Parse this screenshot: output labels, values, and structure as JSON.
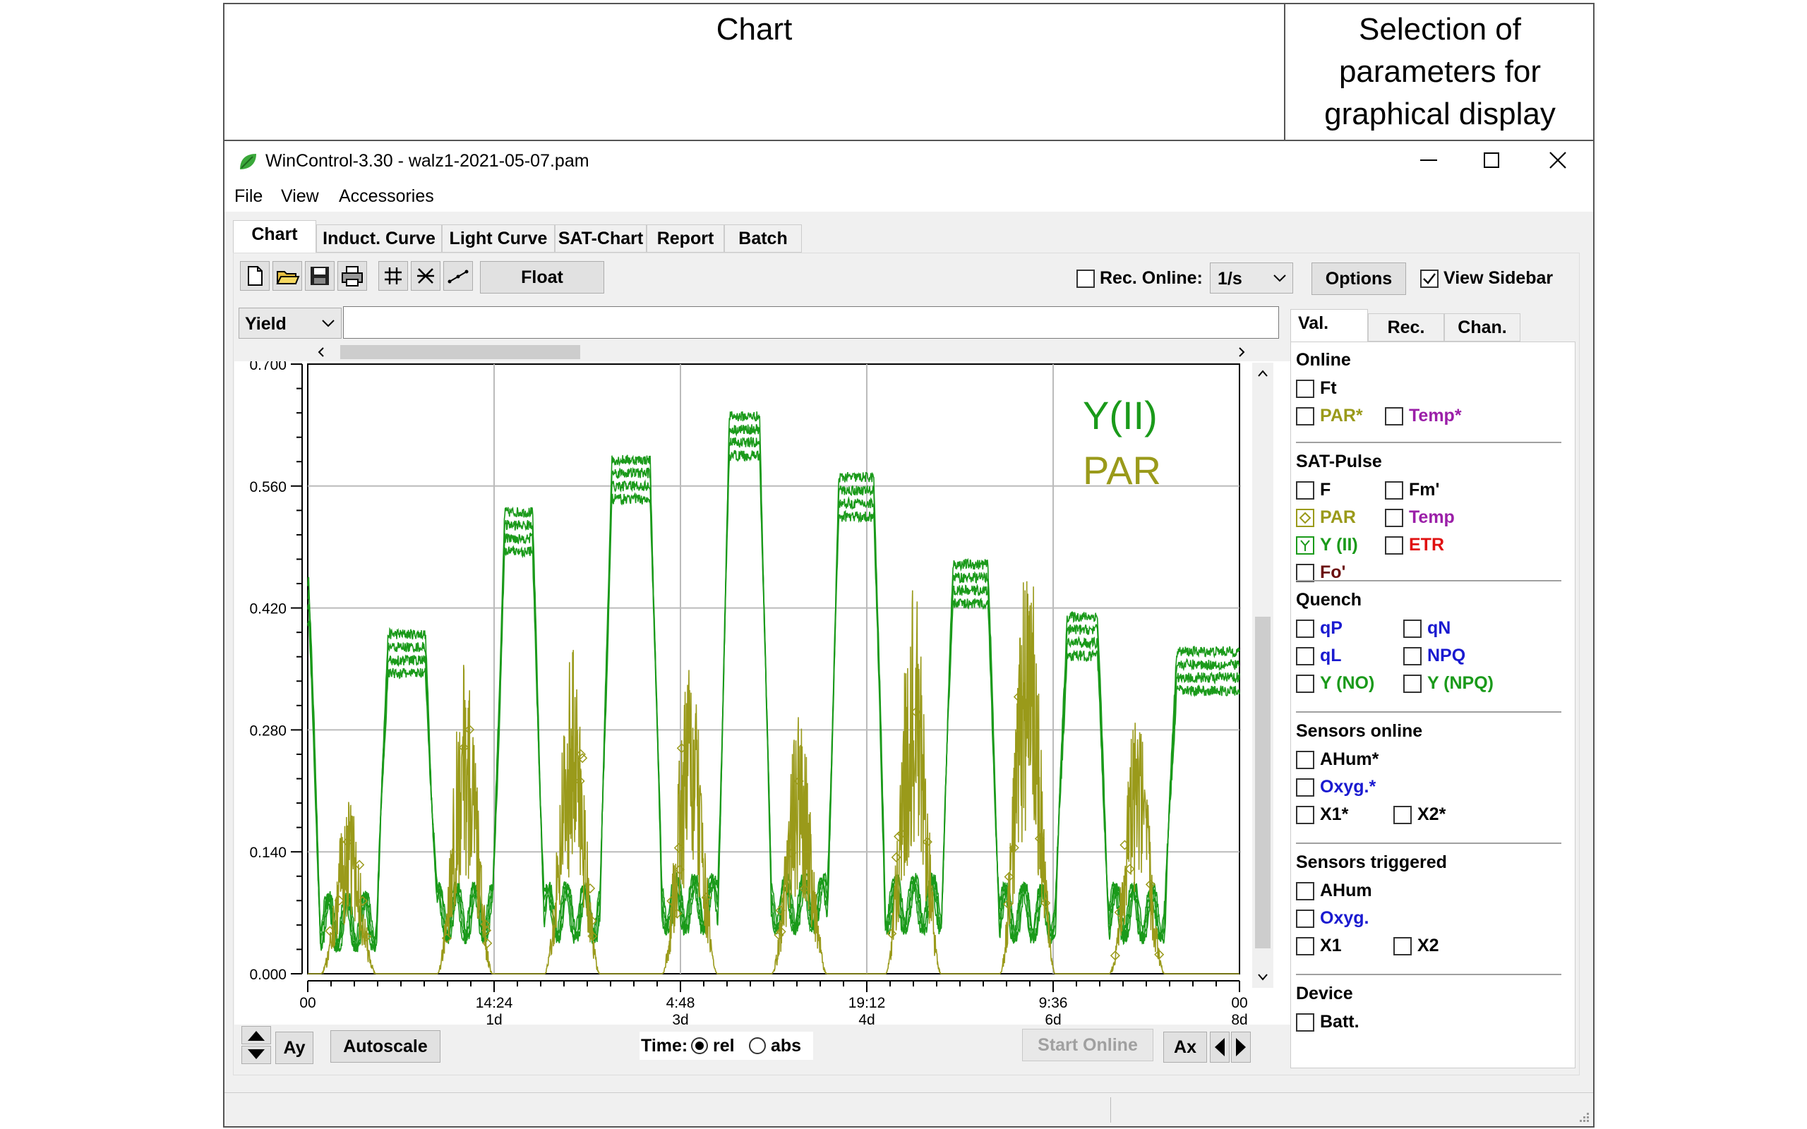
{
  "annotations": {
    "left": "Chart",
    "right": "Selection of parameters for graphical display"
  },
  "window": {
    "title": "WinControl-3.30 - walz1-2021-05-07.pam"
  },
  "menu": [
    "File",
    "View",
    "Accessories"
  ],
  "tabs": [
    "Chart",
    "Induct. Curve",
    "Light Curve",
    "SAT-Chart",
    "Report",
    "Batch"
  ],
  "toolbar": {
    "float_label": "Float",
    "rec_online_label": "Rec. Online:",
    "rec_interval": "1/s",
    "options_label": "Options",
    "view_sidebar_label": "View Sidebar",
    "view_sidebar_checked": true,
    "rec_online_checked": false
  },
  "param_select": {
    "value": "Yield"
  },
  "overlay_labels": {
    "yii": "Y(II)",
    "par": "PAR"
  },
  "bottom": {
    "ay": "Ay",
    "autoscale": "Autoscale",
    "time_label": "Time:",
    "rel": "rel",
    "abs": "abs",
    "start_online": "Start Online",
    "ax": "Ax"
  },
  "sidebar": {
    "tabs": [
      "Val.",
      "Rec.",
      "Chan."
    ],
    "sections": [
      {
        "title": "Online",
        "items": [
          {
            "label": "Ft",
            "color": "#000000",
            "checked": false
          },
          {
            "label": "PAR*",
            "color": "#9a9a1a",
            "checked": false
          },
          {
            "label": "Temp*",
            "color": "#9b1fa8",
            "checked": false
          }
        ]
      },
      {
        "title": "SAT-Pulse",
        "items": [
          {
            "label": "F",
            "color": "#000000",
            "checked": false
          },
          {
            "label": "Fm'",
            "color": "#000000",
            "checked": false
          },
          {
            "label": "PAR",
            "color": "#9a9a1a",
            "checked": true
          },
          {
            "label": "Temp",
            "color": "#9b1fa8",
            "checked": false
          },
          {
            "label": "Y (II)",
            "color": "#1a9a1a",
            "checked": true
          },
          {
            "label": "ETR",
            "color": "#e01010",
            "checked": false
          },
          {
            "label": "Fo'",
            "color": "#6b1010",
            "checked": false
          }
        ]
      },
      {
        "title": "Quench",
        "items": [
          {
            "label": "qP",
            "color": "#1a1ad0",
            "checked": false
          },
          {
            "label": "qN",
            "color": "#1a1ad0",
            "checked": false
          },
          {
            "label": "qL",
            "color": "#1a1ad0",
            "checked": false
          },
          {
            "label": "NPQ",
            "color": "#1a1ad0",
            "checked": false
          },
          {
            "label": "Y (NO)",
            "color": "#1a9a1a",
            "checked": false
          },
          {
            "label": "Y (NPQ)",
            "color": "#1a9a1a",
            "checked": false
          }
        ]
      },
      {
        "title": "Sensors online",
        "items": [
          {
            "label": "AHum*",
            "color": "#000000",
            "checked": false
          },
          {
            "label": "Oxyg.*",
            "color": "#1a1ad0",
            "checked": false
          },
          {
            "label": "X1*",
            "color": "#000000",
            "checked": false
          },
          {
            "label": "X2*",
            "color": "#000000",
            "checked": false
          }
        ]
      },
      {
        "title": "Sensors triggered",
        "items": [
          {
            "label": "AHum",
            "color": "#000000",
            "checked": false
          },
          {
            "label": "Oxyg.",
            "color": "#1a1ad0",
            "checked": false
          },
          {
            "label": "X1",
            "color": "#000000",
            "checked": false
          },
          {
            "label": "X2",
            "color": "#000000",
            "checked": false
          }
        ]
      },
      {
        "title": "Device",
        "items": [
          {
            "label": "Batt.",
            "color": "#000000",
            "checked": false
          }
        ]
      }
    ]
  },
  "chart_data": {
    "type": "line",
    "title": "",
    "ylim": [
      0,
      0.7
    ],
    "y_ticks": [
      "0.700",
      "0.560",
      "0.420",
      "0.280",
      "0.140",
      "0.000"
    ],
    "y_tick_values": [
      0.7,
      0.56,
      0.42,
      0.28,
      0.14,
      0
    ],
    "x_ticks": [
      {
        "time": "00",
        "day": ""
      },
      {
        "time": "14:24",
        "day": "1d"
      },
      {
        "time": "4:48",
        "day": "3d"
      },
      {
        "time": "19:12",
        "day": "4d"
      },
      {
        "time": "9:36",
        "day": "6d"
      },
      {
        "time": "00",
        "day": "8d"
      }
    ],
    "x_tick_days": [
      0,
      1.6,
      3.2,
      4.8,
      6.4,
      8.0
    ],
    "xlim_days": [
      0,
      8
    ],
    "grid": true,
    "series": [
      {
        "name": "Y(II)",
        "color": "#1a9a1a",
        "night_levels": [
          0.45,
          0.39,
          0.53,
          0.59,
          0.64,
          0.57,
          0.47,
          0.41,
          0.37
        ],
        "day_min": [
          0.06,
          0.07,
          0.07,
          0.08,
          0.08,
          0.08,
          0.07,
          0.07
        ]
      },
      {
        "name": "PAR",
        "color": "#9a9a1a",
        "day_peaks": [
          0.2,
          0.36,
          0.38,
          0.36,
          0.3,
          0.45,
          0.5,
          0.3
        ]
      }
    ]
  }
}
